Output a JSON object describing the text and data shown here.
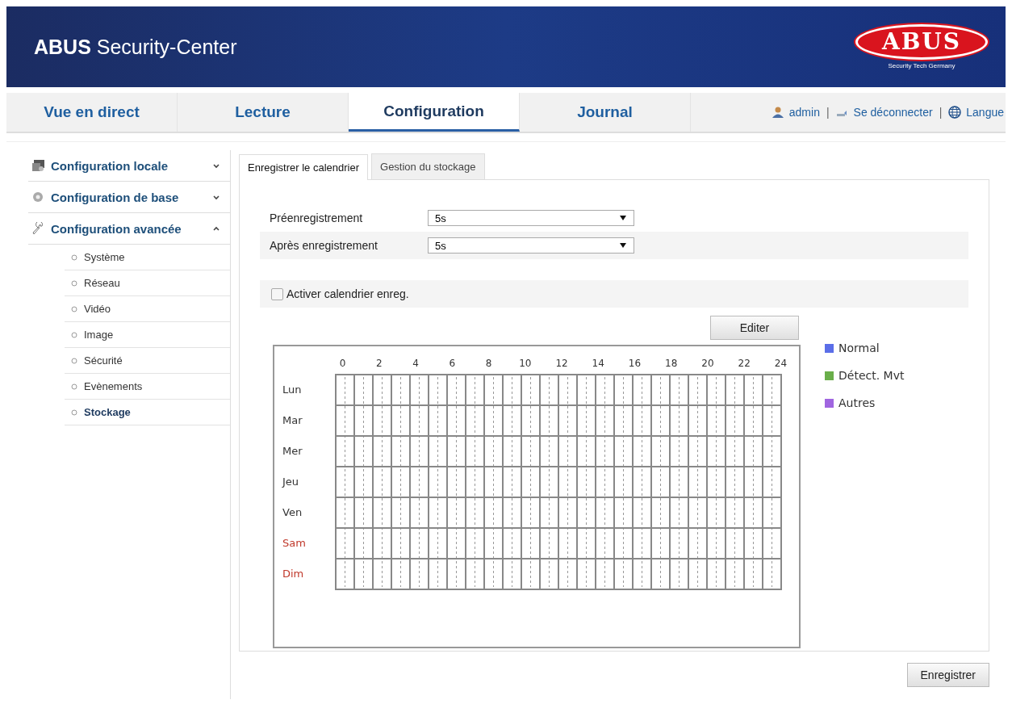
{
  "header": {
    "title_bold": "ABUS",
    "title": "Security-Center",
    "logo_text": "ABUS",
    "logo_tagline": "Security Tech Germany"
  },
  "nav": {
    "tabs": [
      {
        "label": "Vue en direct",
        "selected": false
      },
      {
        "label": "Lecture",
        "selected": false
      },
      {
        "label": "Configuration",
        "selected": true
      },
      {
        "label": "Journal",
        "selected": false
      }
    ],
    "user_menu": [
      {
        "kind": "user",
        "label": "admin"
      },
      {
        "kind": "separator",
        "label": "|"
      },
      {
        "kind": "logout",
        "label": "Se déconnecter"
      },
      {
        "kind": "separator",
        "label": "|"
      },
      {
        "kind": "language",
        "label": "Langue"
      }
    ]
  },
  "sidebar": {
    "items": [
      {
        "kind": "monitor",
        "label": "Configuration locale",
        "expanded": false
      },
      {
        "kind": "gear",
        "label": "Configuration de base",
        "expanded": false
      },
      {
        "kind": "wrench",
        "label": "Configuration avancée",
        "expanded": true,
        "children": [
          {
            "label": "Système",
            "selected": false
          },
          {
            "label": "Réseau",
            "selected": false
          },
          {
            "label": "Vidéo",
            "selected": false
          },
          {
            "label": "Image",
            "selected": false
          },
          {
            "label": "Sécurité",
            "selected": false
          },
          {
            "label": "Evènements",
            "selected": false
          },
          {
            "label": "Stockage",
            "selected": true
          }
        ]
      }
    ]
  },
  "tabs": [
    {
      "label": "Enregistrer le calendrier",
      "selected": true
    },
    {
      "label": "Gestion du stockage",
      "selected": false
    }
  ],
  "fields": [
    {
      "label": "Préenregistrement",
      "value": "5s"
    },
    {
      "label": "Après enregistrement",
      "value": "5s"
    }
  ],
  "enable_schedule": {
    "label": "Activer calendrier enreg.",
    "checked": false
  },
  "edit_button": "Editer",
  "schedule": {
    "hours": [
      "0",
      "2",
      "4",
      "6",
      "8",
      "10",
      "12",
      "14",
      "16",
      "18",
      "20",
      "22",
      "24"
    ],
    "days": [
      {
        "label": "Lun",
        "kind": "weekday"
      },
      {
        "label": "Mar",
        "kind": "weekday"
      },
      {
        "label": "Mer",
        "kind": "weekday"
      },
      {
        "label": "Jeu",
        "kind": "weekday"
      },
      {
        "label": "Ven",
        "kind": "weekday"
      },
      {
        "label": "Sam",
        "kind": "weekend"
      },
      {
        "label": "Dim",
        "kind": "weekend"
      }
    ]
  },
  "legend": [
    {
      "label": "Normal",
      "color": "#5b6ee8"
    },
    {
      "label": "Détect. Mvt",
      "color": "#6aae4a"
    },
    {
      "label": "Autres",
      "color": "#a066e0"
    }
  ],
  "save_button": "Enregistrer"
}
